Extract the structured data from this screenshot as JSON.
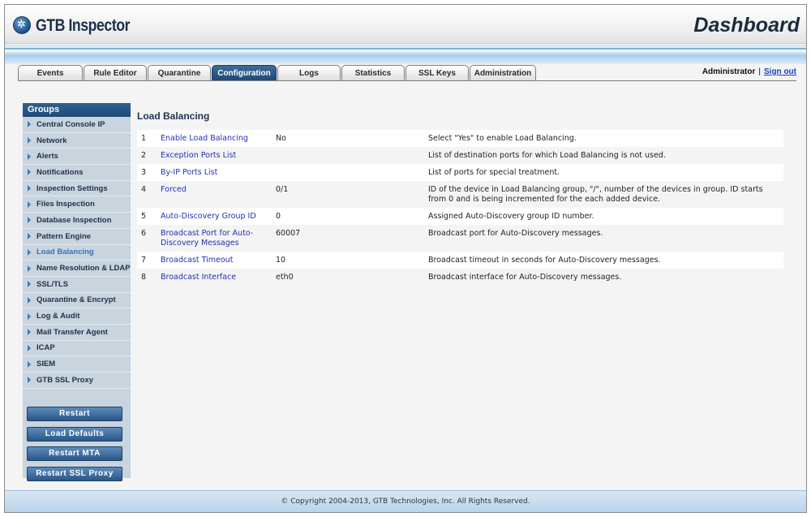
{
  "header": {
    "brand": "GTB Inspector",
    "page_title": "Dashboard",
    "user": "Administrator",
    "separator": "|",
    "sign_out": "Sign out"
  },
  "tabs": [
    {
      "label": "Events",
      "active": false
    },
    {
      "label": "Rule Editor",
      "active": false
    },
    {
      "label": "Quarantine",
      "active": false
    },
    {
      "label": "Configuration",
      "active": true
    },
    {
      "label": "Logs",
      "active": false
    },
    {
      "label": "Statistics",
      "active": false
    },
    {
      "label": "SSL Keys",
      "active": false
    },
    {
      "label": "Administration",
      "active": false
    }
  ],
  "sidebar": {
    "heading": "Groups",
    "items": [
      {
        "label": "Central Console IP"
      },
      {
        "label": "Network"
      },
      {
        "label": "Alerts"
      },
      {
        "label": "Notifications"
      },
      {
        "label": "Inspection Settings"
      },
      {
        "label": "Files Inspection"
      },
      {
        "label": "Database Inspection"
      },
      {
        "label": "Pattern Engine"
      },
      {
        "label": "Load Balancing",
        "active": true
      },
      {
        "label": "Name Resolution & LDAP"
      },
      {
        "label": "SSL/TLS"
      },
      {
        "label": "Quarantine & Encrypt"
      },
      {
        "label": "Log & Audit"
      },
      {
        "label": "Mail Transfer Agent"
      },
      {
        "label": "ICAP"
      },
      {
        "label": "SIEM"
      },
      {
        "label": "GTB SSL Proxy"
      }
    ],
    "buttons": [
      "Restart",
      "Load Defaults",
      "Restart MTA",
      "Restart SSL Proxy"
    ]
  },
  "main": {
    "section_title": "Load Balancing",
    "rows": [
      {
        "num": "1",
        "name": "Enable Load Balancing",
        "value": "No",
        "desc": "Select \"Yes\" to enable Load Balancing."
      },
      {
        "num": "2",
        "name": "Exception Ports List",
        "value": "",
        "desc": "List of destination ports for which Load Balancing is not used."
      },
      {
        "num": "3",
        "name": "By-IP Ports List",
        "value": "",
        "desc": "List of ports for special treatment."
      },
      {
        "num": "4",
        "name": "Forced",
        "value": "0/1",
        "desc": "ID of the device in Load Balancing group, \"/\", number of the devices in group. ID starts from 0 and is being incremented for the each added device."
      },
      {
        "num": "5",
        "name": "Auto-Discovery Group ID",
        "value": "0",
        "desc": "Assigned Auto-Discovery group ID number."
      },
      {
        "num": "6",
        "name": "Broadcast Port for Auto-Discovery Messages",
        "value": "60007",
        "desc": "Broadcast port for Auto-Discovery messages."
      },
      {
        "num": "7",
        "name": "Broadcast Timeout",
        "value": "10",
        "desc": "Broadcast timeout in seconds for Auto-Discovery messages."
      },
      {
        "num": "8",
        "name": "Broadcast Interface",
        "value": "eth0",
        "desc": "Broadcast interface for Auto-Discovery messages."
      }
    ]
  },
  "footer": {
    "copyright": "© Copyright 2004-2013, GTB Technologies, Inc. All Rights Reserved."
  }
}
